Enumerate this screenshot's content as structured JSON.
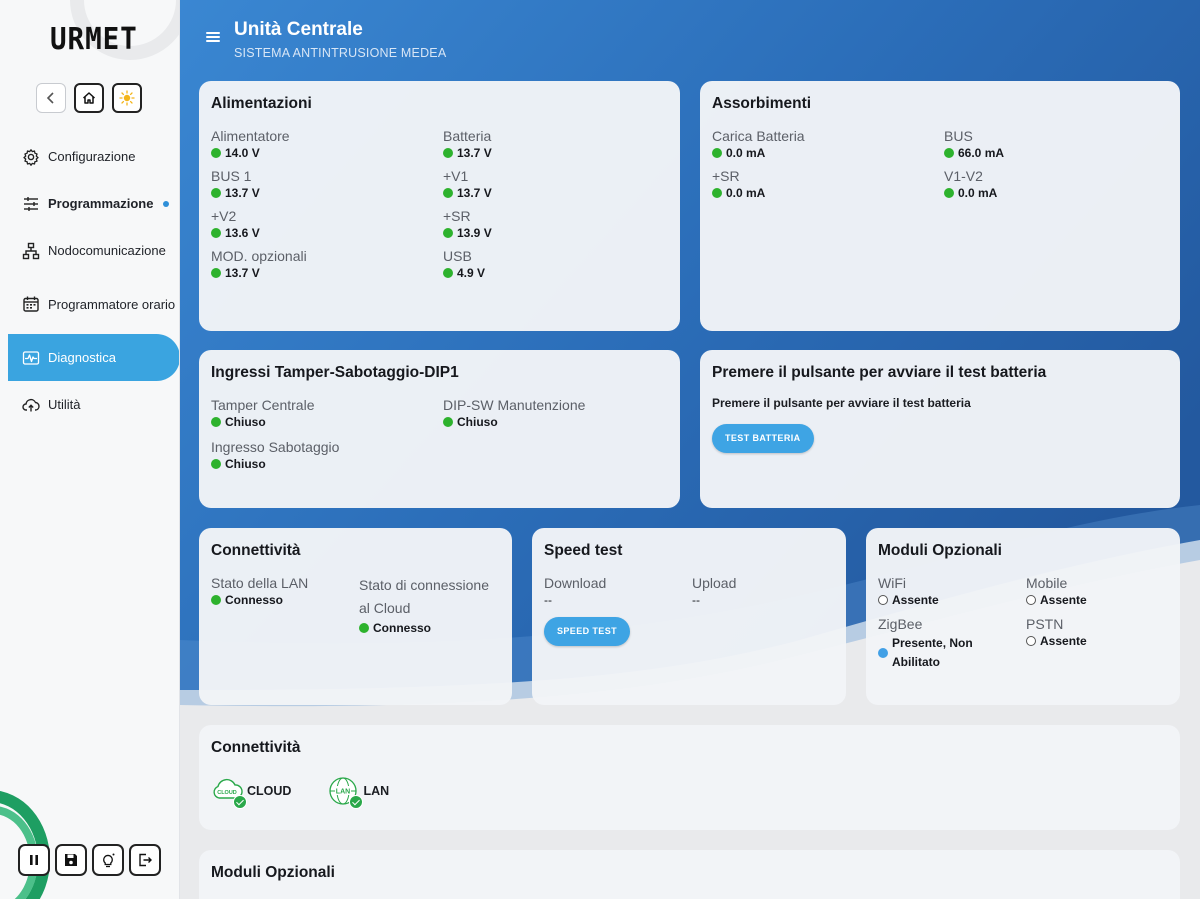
{
  "brand": {
    "logo": "URMET"
  },
  "header": {
    "title": "Unità Centrale",
    "subtitle": "SISTEMA ANTINTRUSIONE MEDEA"
  },
  "sidebar": {
    "items": [
      {
        "label": "Configurazione",
        "icon": "gear-icon"
      },
      {
        "label": "Programmazione",
        "icon": "sliders-icon"
      },
      {
        "label": "Nodocomunicazione",
        "icon": "network-icon"
      },
      {
        "label": "Programmatore orario",
        "icon": "calendar-icon"
      },
      {
        "label": "Diagnostica",
        "icon": "pulse-icon",
        "active": true
      },
      {
        "label": "Utilità",
        "icon": "cloud-upload-icon"
      }
    ]
  },
  "alimentazioni": {
    "title": "Alimentazioni",
    "items": [
      {
        "label": "Alimentatore",
        "value": "14.0 V"
      },
      {
        "label": "Batteria",
        "value": "13.7 V"
      },
      {
        "label": "BUS 1",
        "value": "13.7 V"
      },
      {
        "label": "+V1",
        "value": "13.7 V"
      },
      {
        "label": "+V2",
        "value": "13.6 V"
      },
      {
        "label": "+SR",
        "value": "13.9 V"
      },
      {
        "label": "MOD. opzionali",
        "value": "13.7 V"
      },
      {
        "label": "USB",
        "value": "4.9 V"
      }
    ]
  },
  "assorbimenti": {
    "title": "Assorbimenti",
    "items": [
      {
        "label": "Carica Batteria",
        "value": "0.0 mA"
      },
      {
        "label": "BUS",
        "value": "66.0 mA"
      },
      {
        "label": "+SR",
        "value": "0.0 mA"
      },
      {
        "label": "V1-V2",
        "value": "0.0 mA"
      }
    ]
  },
  "ingressi": {
    "title": "Ingressi Tamper-Sabotaggio-DIP1",
    "items": [
      {
        "label": "Tamper Centrale",
        "value": "Chiuso"
      },
      {
        "label": "DIP-SW Manutenzione",
        "value": "Chiuso"
      },
      {
        "label": "Ingresso Sabotaggio",
        "value": "Chiuso"
      }
    ]
  },
  "test_batteria": {
    "title": "Premere il pulsante per avviare il test batteria",
    "text": "Premere il pulsante per avviare il test batteria",
    "button": "TEST BATTERIA"
  },
  "connettivita": {
    "title": "Connettività",
    "lan_label": "Stato della LAN",
    "lan_value": "Connesso",
    "cloud_label": "Stato di connessione al Cloud",
    "cloud_value": "Connesso"
  },
  "speed_test": {
    "title": "Speed test",
    "download_label": "Download",
    "download_value": "--",
    "upload_label": "Upload",
    "upload_value": "--",
    "button": "SPEED TEST"
  },
  "moduli": {
    "title": "Moduli Opzionali",
    "wifi_label": "WiFi",
    "wifi_value": "Assente",
    "mobile_label": "Mobile",
    "mobile_value": "Assente",
    "zigbee_label": "ZigBee",
    "zigbee_value": "Presente, Non Abilitato",
    "pstn_label": "PSTN",
    "pstn_value": "Assente"
  },
  "connettivita2": {
    "title": "Connettività",
    "cloud": "CLOUD",
    "cloud_icon_text": "CLOUD",
    "lan": "LAN",
    "lan_icon_text": "LAN"
  },
  "moduli2": {
    "title": "Moduli Opzionali"
  },
  "colors": {
    "accent": "#3aa4e0",
    "header_blue": "#2a6fb8",
    "ok_green": "#2db22d"
  }
}
